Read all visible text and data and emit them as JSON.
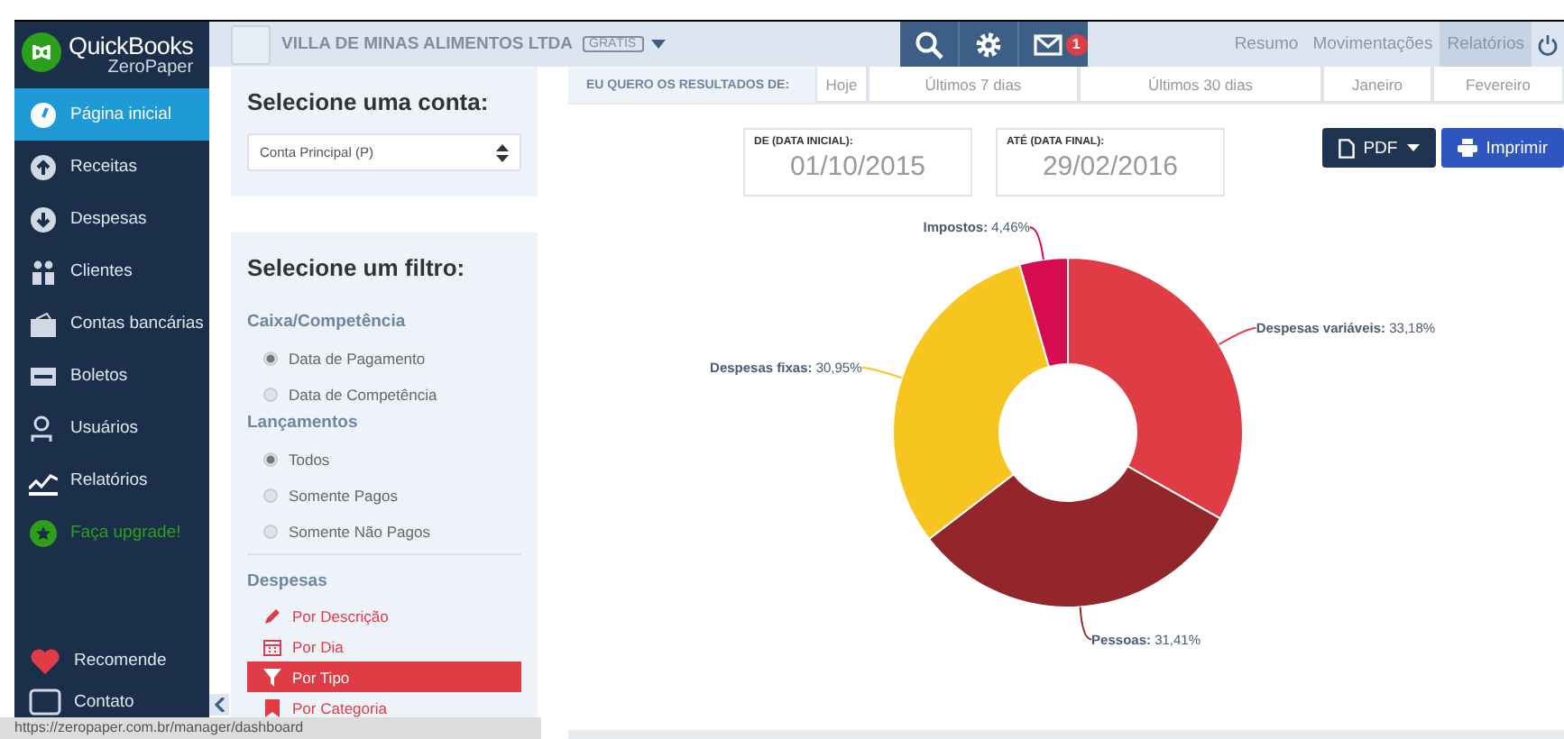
{
  "logo": {
    "brand": "QuickBooks",
    "product": "ZeroPaper"
  },
  "sidebar": {
    "items": [
      {
        "label": "Página inicial",
        "kind": "gauge",
        "selected": true
      },
      {
        "label": "Receitas",
        "kind": "up",
        "selected": false
      },
      {
        "label": "Despesas",
        "kind": "down",
        "selected": false
      },
      {
        "label": "Clientes",
        "kind": "people",
        "selected": false
      },
      {
        "label": "Contas bancárias",
        "kind": "wallet",
        "selected": false
      },
      {
        "label": "Boletos",
        "kind": "card",
        "selected": false
      },
      {
        "label": "Usuários",
        "kind": "user",
        "selected": false
      },
      {
        "label": "Relatórios",
        "kind": "chart",
        "selected": false
      },
      {
        "label": "Faça upgrade!",
        "kind": "upgrade",
        "selected": false
      }
    ],
    "bottom_items": [
      {
        "label": "Recomende",
        "kind": "heart"
      },
      {
        "label": "Contato",
        "kind": "chat"
      }
    ]
  },
  "topbar": {
    "company": "VILLA DE MINAS ALIMENTOS LTDA",
    "plan_badge": "GRÁTIS",
    "mail_count": "1",
    "nav": [
      {
        "label": "Resumo",
        "selected": false
      },
      {
        "label": "Movimentações",
        "selected": false
      },
      {
        "label": "Relatórios",
        "selected": true
      }
    ]
  },
  "account_panel": {
    "title": "Selecione uma conta:",
    "select_value": "Conta Principal (P)"
  },
  "filter_panel": {
    "title": "Selecione um filtro:",
    "groups": [
      {
        "heading": "Caixa/Competência",
        "options": [
          {
            "label": "Data de Pagamento",
            "selected": true
          },
          {
            "label": "Data de Competência",
            "selected": false
          }
        ]
      },
      {
        "heading": "Lançamentos",
        "options": [
          {
            "label": "Todos",
            "selected": true
          },
          {
            "label": "Somente Pagos",
            "selected": false
          },
          {
            "label": "Somente Não Pagos",
            "selected": false
          }
        ]
      }
    ],
    "expenses_heading": "Despesas",
    "expense_links": [
      {
        "label": "Por Descrição",
        "kind": "pencil",
        "selected": false
      },
      {
        "label": "Por Dia",
        "kind": "calendar",
        "selected": false
      },
      {
        "label": "Por Tipo",
        "kind": "filter",
        "selected": true
      },
      {
        "label": "Por Categoria",
        "kind": "bookmark",
        "selected": false
      }
    ]
  },
  "period_bar": {
    "label": "EU QUERO OS RESULTADOS DE:",
    "options": [
      "Hoje",
      "Últimos 7 dias",
      "Últimos 30 dias",
      "Janeiro",
      "Fevereiro"
    ]
  },
  "date_range": [
    {
      "label": "DE (DATA INICIAL):",
      "value": "01/10/2015"
    },
    {
      "label": "ATÉ (DATA FINAL):",
      "value": "29/02/2016"
    }
  ],
  "actions": [
    {
      "label": "PDF",
      "kind": "pdf"
    },
    {
      "label": "Imprimir",
      "kind": "print"
    }
  ],
  "chart_data": {
    "type": "donut",
    "values": [
      33.18,
      31.41,
      30.95,
      4.46
    ],
    "colors": [
      "#e03c45",
      "#93262a",
      "#f7c520",
      "#d70c50"
    ],
    "value_labels": [
      "**Despesas variáveis:** 33,18%",
      "**Pessoas:** 31,41%",
      "**Despesas fixas:** 30,95%",
      "**Impostos:** 4,46%"
    ]
  },
  "status_bar": {
    "url": "https://zeropaper.com.br/manager/dashboard"
  }
}
